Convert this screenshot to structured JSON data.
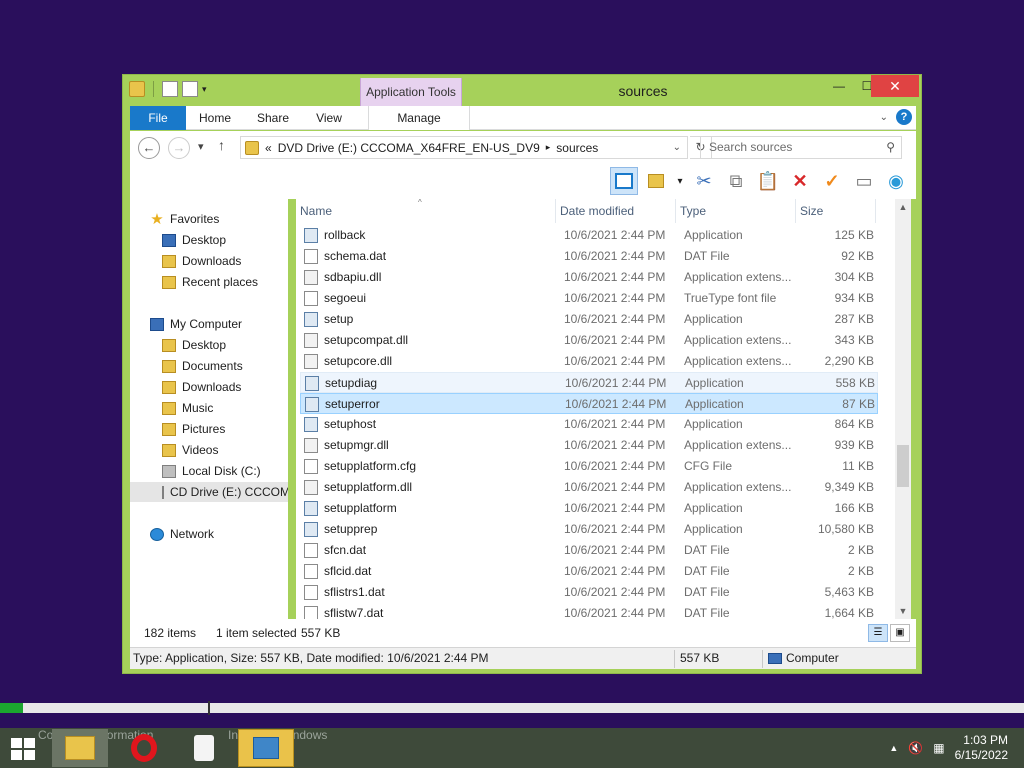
{
  "window": {
    "title": "sources",
    "contextual_tab": "Application Tools",
    "minimize": "—",
    "maximize": "☐",
    "close": "✕"
  },
  "ribbon": {
    "tabs": [
      "File",
      "Home",
      "Share",
      "View",
      "Manage"
    ]
  },
  "address": {
    "prefix": "«",
    "path": [
      "DVD Drive (E:) CCCOMA_X64FRE_EN-US_DV9",
      "sources"
    ],
    "search_placeholder": "Search sources"
  },
  "nav_pane": {
    "favorites_label": "Favorites",
    "favorites": [
      "Desktop",
      "Downloads",
      "Recent places"
    ],
    "computer_label": "My Computer",
    "computer": [
      "Desktop",
      "Documents",
      "Downloads",
      "Music",
      "Pictures",
      "Videos",
      "Local Disk (C:)",
      "CD Drive (E:) CCCOMA"
    ],
    "network_label": "Network"
  },
  "columns": {
    "name": "Name",
    "date": "Date modified",
    "type": "Type",
    "size": "Size"
  },
  "files": [
    {
      "name": "rollback",
      "date": "10/6/2021 2:44 PM",
      "type": "Application",
      "size": "125 KB"
    },
    {
      "name": "schema.dat",
      "date": "10/6/2021 2:44 PM",
      "type": "DAT File",
      "size": "92 KB"
    },
    {
      "name": "sdbapiu.dll",
      "date": "10/6/2021 2:44 PM",
      "type": "Application extens...",
      "size": "304 KB"
    },
    {
      "name": "segoeui",
      "date": "10/6/2021 2:44 PM",
      "type": "TrueType font file",
      "size": "934 KB"
    },
    {
      "name": "setup",
      "date": "10/6/2021 2:44 PM",
      "type": "Application",
      "size": "287 KB"
    },
    {
      "name": "setupcompat.dll",
      "date": "10/6/2021 2:44 PM",
      "type": "Application extens...",
      "size": "343 KB"
    },
    {
      "name": "setupcore.dll",
      "date": "10/6/2021 2:44 PM",
      "type": "Application extens...",
      "size": "2,290 KB"
    },
    {
      "name": "setupdiag",
      "date": "10/6/2021 2:44 PM",
      "type": "Application",
      "size": "558 KB"
    },
    {
      "name": "setuperror",
      "date": "10/6/2021 2:44 PM",
      "type": "Application",
      "size": "87 KB"
    },
    {
      "name": "setuphost",
      "date": "10/6/2021 2:44 PM",
      "type": "Application",
      "size": "864 KB"
    },
    {
      "name": "setupmgr.dll",
      "date": "10/6/2021 2:44 PM",
      "type": "Application extens...",
      "size": "939 KB"
    },
    {
      "name": "setupplatform.cfg",
      "date": "10/6/2021 2:44 PM",
      "type": "CFG File",
      "size": "11 KB"
    },
    {
      "name": "setupplatform.dll",
      "date": "10/6/2021 2:44 PM",
      "type": "Application extens...",
      "size": "9,349 KB"
    },
    {
      "name": "setupplatform",
      "date": "10/6/2021 2:44 PM",
      "type": "Application",
      "size": "166 KB"
    },
    {
      "name": "setupprep",
      "date": "10/6/2021 2:44 PM",
      "type": "Application",
      "size": "10,580 KB"
    },
    {
      "name": "sfcn.dat",
      "date": "10/6/2021 2:44 PM",
      "type": "DAT File",
      "size": "2 KB"
    },
    {
      "name": "sflcid.dat",
      "date": "10/6/2021 2:44 PM",
      "type": "DAT File",
      "size": "2 KB"
    },
    {
      "name": "sflistrs1.dat",
      "date": "10/6/2021 2:44 PM",
      "type": "DAT File",
      "size": "5,463 KB"
    },
    {
      "name": "sflistw7.dat",
      "date": "10/6/2021 2:44 PM",
      "type": "DAT File",
      "size": "1,664 KB"
    }
  ],
  "selection": {
    "hovered_index": 7,
    "selected_index": 8
  },
  "countbar": {
    "items": "182 items",
    "selected": "1 item selected",
    "size": "557 KB"
  },
  "statusbar": {
    "details": "Type: Application, Size: 557 KB, Date modified: 10/6/2021 2:44 PM",
    "size": "557 KB",
    "location": "Computer"
  },
  "progress": {
    "fraction": 0.022
  },
  "taskbar": {
    "overlay_left": "Collecting information",
    "overlay_right": "Installing Windows",
    "time": "1:03 PM",
    "date": "6/15/2022"
  },
  "colors": {
    "window_frame": "#a6d15a",
    "file_tab": "#1979ca",
    "context_tab": "#e7d2ef",
    "desktop": "#2a0f5c",
    "selection": "#cce8ff",
    "progress": "#1ba62f"
  },
  "icons": {
    "favorites": "star-icon",
    "computer": "computer-icon",
    "network": "network-icon",
    "folder": "folder-icon"
  }
}
